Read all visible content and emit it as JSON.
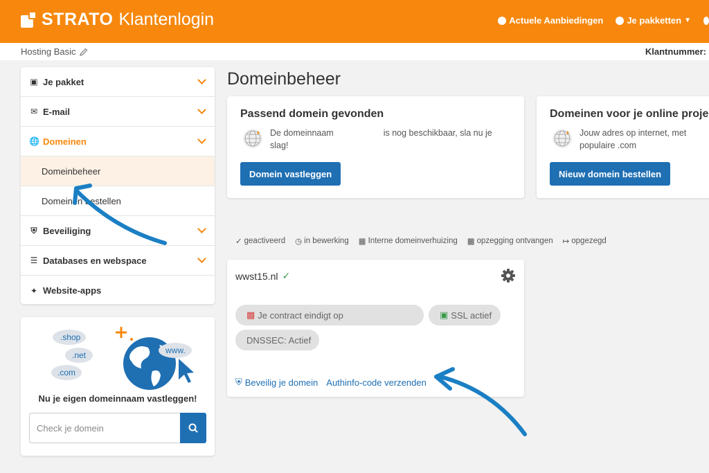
{
  "header": {
    "brand": "STRATO",
    "subtitle": "Klantenlogin",
    "nav": [
      "Actuele Aanbiedingen",
      "Je pakketten"
    ]
  },
  "subbar": {
    "package": "Hosting Basic",
    "customer_label": "Klantnummer:"
  },
  "sidebar": {
    "items": [
      {
        "label": "Je pakket",
        "icon": "box-icon"
      },
      {
        "label": "E-mail",
        "icon": "envelope-icon"
      },
      {
        "label": "Domeinen",
        "icon": "globe-icon",
        "active": true
      },
      {
        "label": "Beveiliging",
        "icon": "shield-icon"
      },
      {
        "label": "Databases en webspace",
        "icon": "database-icon"
      },
      {
        "label": "Website-apps",
        "icon": "magic-wand-icon"
      }
    ],
    "subitems": [
      "Domeinbeheer",
      "Domeinen bestellen"
    ]
  },
  "promo": {
    "tags": [
      ".shop",
      ".net",
      ".com",
      "www."
    ],
    "text": "Nu je eigen domeinnaam vastleggen!",
    "placeholder": "Check je domein"
  },
  "main": {
    "title": "Domeinbeheer",
    "card1": {
      "title": "Passend domein gevonden",
      "desc_a": "De domeinnaam",
      "desc_b": "is nog beschikbaar, sla nu je slag!",
      "button": "Domein vastleggen"
    },
    "card2": {
      "title": "Domeinen voor je online project",
      "desc": "Jouw adres op internet, met populaire .com",
      "button": "Nieuw domein bestellen"
    },
    "legend": [
      "geactiveerd",
      "in bewerking",
      "Interne domeinverhuizing",
      "opzegging ontvangen",
      "opgezegd"
    ],
    "domain": {
      "name": "wwst15.nl",
      "contract": "Je contract eindigt op",
      "ssl": "SSL actief",
      "dnssec": "DNSSEC: Actief",
      "link1": "Beveilig je domein",
      "link2": "Authinfo-code verzenden"
    }
  },
  "colors": {
    "brand": "#f7880d",
    "primary": "#1f6fb3",
    "annotation": "#1b7fc4"
  }
}
